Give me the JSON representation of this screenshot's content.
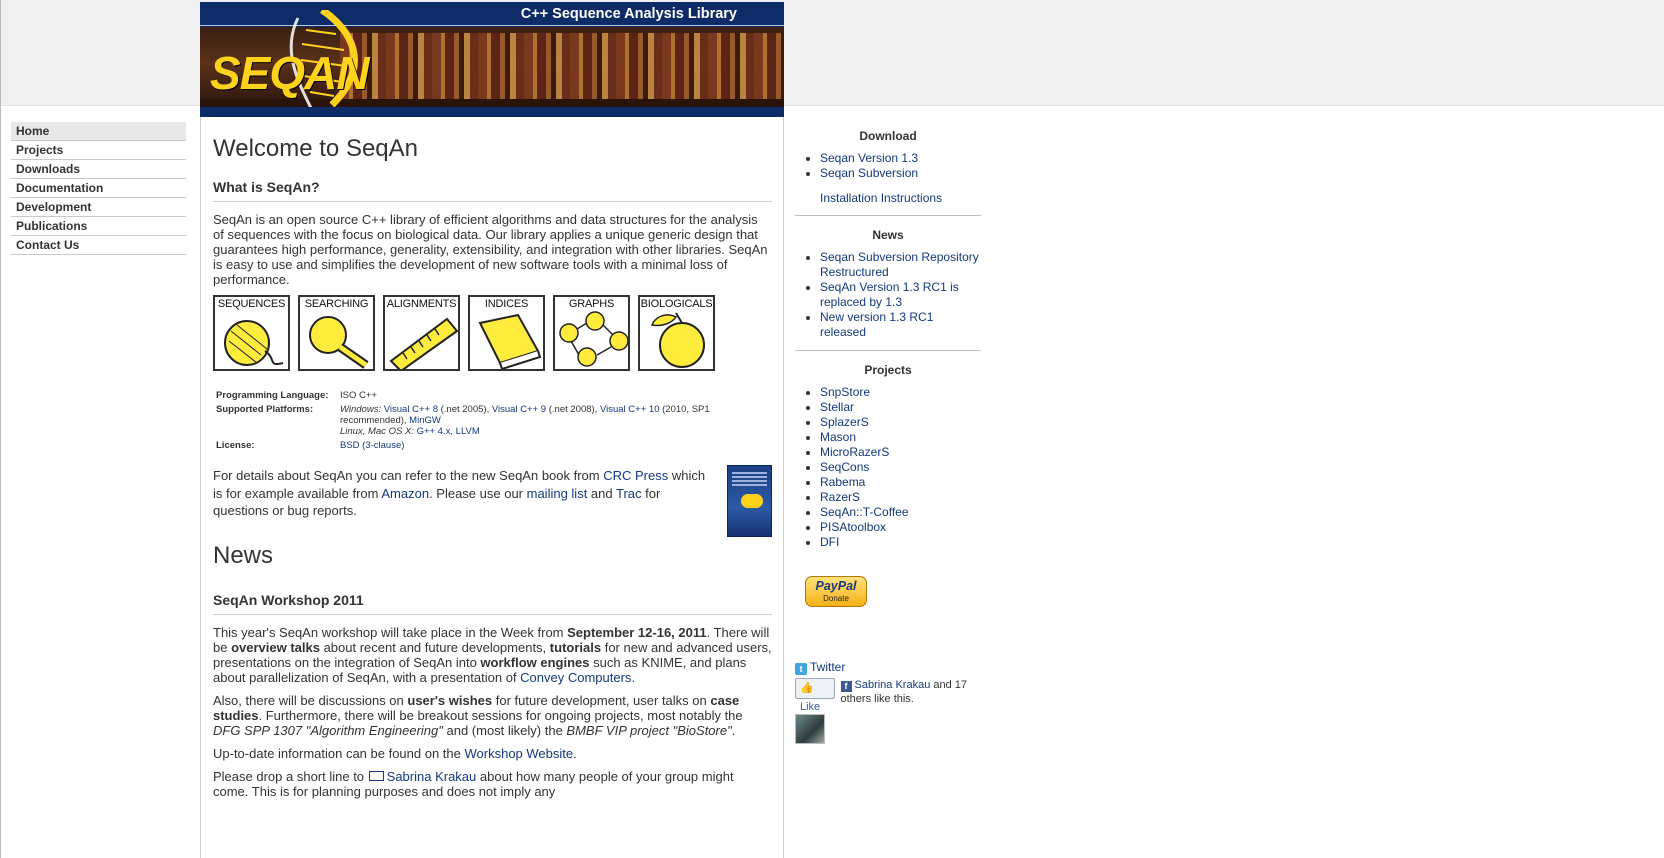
{
  "header": {
    "tagline": "C++ Sequence Analysis Library",
    "logo_text": "SEQAN"
  },
  "nav": [
    {
      "label": "Home",
      "active": true
    },
    {
      "label": "Projects"
    },
    {
      "label": "Downloads"
    },
    {
      "label": "Documentation"
    },
    {
      "label": "Development"
    },
    {
      "label": "Publications"
    },
    {
      "label": "Contact Us"
    }
  ],
  "main": {
    "title": "Welcome to SeqAn",
    "what_heading": "What is SeqAn?",
    "intro": "SeqAn is an open source C++ library of efficient algorithms and data structures for the analysis of sequences with the focus on biological data. Our library applies a unique generic design that guarantees high performance, generality, extensibility, and integration with other libraries. SeqAn is easy to use and simplifies the development of new software tools with a minimal loss of performance.",
    "tiles": [
      "SEQUENCES",
      "SEARCHING",
      "ALIGNMENTS",
      "INDICES",
      "GRAPHS",
      "BIOLOGICALS"
    ],
    "info": {
      "lang_label": "Programming Language:",
      "lang_value": "ISO C++",
      "platforms_label": "Supported Platforms:",
      "windows_prefix": "Windows:",
      "vc8": "Visual C++ 8",
      "vc8_note": "(.net 2005),",
      "vc9": "Visual C++ 9",
      "vc9_note": "(.net 2008),",
      "vc10": "Visual C++ 10",
      "vc10_note": "(2010, SP1 recommended),",
      "mingw": "MinGW",
      "unix_prefix": "Linux, Mac OS X:",
      "gpp": "G++ 4.x",
      "comma": ",",
      "llvm": "LLVM",
      "license_label": "License:",
      "license_value": "BSD (3-clause)"
    },
    "book": {
      "t1": "For details about SeqAn you can refer to the new SeqAn book from ",
      "crc": "CRC Press",
      "t2": " which is for example available from ",
      "amazon": "Amazon",
      "t3": ". Please use our ",
      "mailing": "mailing list",
      "t4": " and ",
      "trac": "Trac",
      "t5": " for questions or bug reports."
    },
    "news_title": "News",
    "workshop": {
      "heading": "SeqAn Workshop 2011",
      "p1_a": "This year's SeqAn workshop will take place in the Week from ",
      "p1_dates": "September 12-16, 2011",
      "p1_b": ". There will be ",
      "p1_overview": "overview talks",
      "p1_c": " about recent and future developments, ",
      "p1_tutorials": "tutorials",
      "p1_d": " for new and advanced users, presentations on the integration of SeqAn into ",
      "p1_workflow": "workflow engines",
      "p1_e": " such as KNIME, and plans about parallelization of SeqAn, with a presentation of ",
      "p1_convey": "Convey Computers",
      "p1_f": ".",
      "p2_a": "Also, there will be discussions on ",
      "p2_wishes": "user's wishes",
      "p2_b": " for future development, user talks on ",
      "p2_case": "case studies",
      "p2_c": ". Furthermore, there will be breakout sessions for ongoing projects, most notably the ",
      "p2_dfg": "DFG SPP 1307 \"Algorithm Engineering\"",
      "p2_d": " and (most likely) the ",
      "p2_bmbf": "BMBF VIP project \"BioStore\"",
      "p2_e": ".",
      "p3_a": "Up-to-date information can be found on the ",
      "p3_link": "Workshop Website",
      "p3_b": ".",
      "p4_a": "Please drop a short line to ",
      "p4_link": "Sabrina Krakau",
      "p4_b": " about how many people of your group might come. This is for planning purposes and does not imply any"
    }
  },
  "sidebar": {
    "download_title": "Download",
    "download_items": [
      "Seqan Version 1.3",
      "Seqan Subversion"
    ],
    "install_link": "Installation Instructions",
    "news_title": "News",
    "news_items": [
      "Seqan Subversion Repository Restructured",
      "SeqAn Version 1.3 RC1 is replaced by 1.3",
      "New version 1.3 RC1 released"
    ],
    "projects_title": "Projects",
    "project_items": [
      "SnpStore",
      "Stellar",
      "SplazerS",
      "Mason",
      "MicroRazerS",
      "SeqCons",
      "Rabema",
      "RazerS",
      "SeqAn::T-Coffee",
      "PISAtoolbox",
      "DFI"
    ],
    "paypal_label": "PayPal",
    "donate_label": "Donate",
    "twitter_label": "Twitter",
    "like_label": "Like",
    "fb_name": "Sabrina Krakau",
    "fb_text": " and 17 others like this."
  }
}
